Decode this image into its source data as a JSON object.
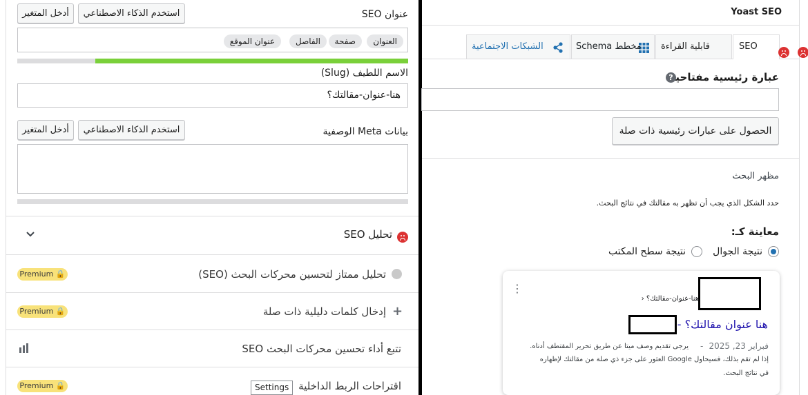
{
  "left": {
    "seo_title": {
      "label": "عنوان SEO",
      "ai_button": "استخدم الذكاء الاصطناعي",
      "insert_var_button": "أدخل المتغير",
      "pills": [
        "العنوان",
        "صفحة",
        "الفاصل",
        "عنوان الموقع"
      ],
      "progress": 0.8
    },
    "slug": {
      "label": "الاسم اللطيف (Slug)",
      "value": "هنا-عنوان-مقالتك؟"
    },
    "meta": {
      "label": "بيانات Meta الوصفية",
      "ai_button": "استخدم الذكاء الاصطناعي",
      "insert_var_button": "أدخل المتغير",
      "value": "",
      "progress": 0
    },
    "sections": [
      {
        "title": "تحليل SEO",
        "icon": "sad-face-icon"
      },
      {
        "title": "تحليل ممتاز لتحسين محركات البحث (SEO)",
        "badge": "Premium",
        "icon": "grey-dot-icon"
      },
      {
        "title": "إدخال كلمات دليلية ذات صلة",
        "badge": "Premium",
        "icon": "plus-icon"
      },
      {
        "title": "تتبع أداء تحسين محركات البحث SEO",
        "icon": "bar-chart-icon"
      },
      {
        "title": "اقتراحات الربط الداخلية",
        "badge": "Premium",
        "extra": "Settings"
      }
    ]
  },
  "right": {
    "header": "Yoast SEO",
    "tabs": [
      {
        "label": "SEO",
        "icon": "sad-face-icon",
        "active": true
      },
      {
        "label": "قابلية القراءة",
        "icon": "sad-face-icon"
      },
      {
        "label": "مخطط Schema",
        "icon": "grid-icon"
      },
      {
        "label": "الشبكات الاجتماعية",
        "icon": "share-icon"
      }
    ],
    "keyphrase_label": "عبارة رئيسية مفتاحية",
    "keyphrase_value": "",
    "related_button": "الحصول على عبارات رئيسية ذات صلة",
    "appearance_title": "مظهر البحث",
    "appearance_desc": "حدد الشكل الذي يجب أن تظهر به مقالتك في نتائج البحث.",
    "preview_label": "معاينة كـ:",
    "preview_options": [
      "نتيجة الجوال",
      "نتيجة سطح المكتب"
    ],
    "preview_selected": "نتيجة الجوال",
    "snippet": {
      "url": "هنا-عنوان-مقالتك؟ ‹",
      "title": "هنا عنوان مقالتك؟ -",
      "date": "فبراير 23, 2025",
      "dash": "-",
      "desc_1": "يرجى تقديم وصف ميتا عن طريق تحرير المقتطف أدناه.",
      "desc_2": "إذا لم تقم بذلك، فسيحاول Google العثور على جزء ذي صلة من مقالتك لإظهاره",
      "desc_3": "في نتائج البحث."
    }
  },
  "colors": {
    "accent": "#2271b1",
    "progress_green": "#7ad03a",
    "bad_red": "#dc3232",
    "premium_yellow": "#f8e27a",
    "link_blue": "#1a0dab"
  }
}
